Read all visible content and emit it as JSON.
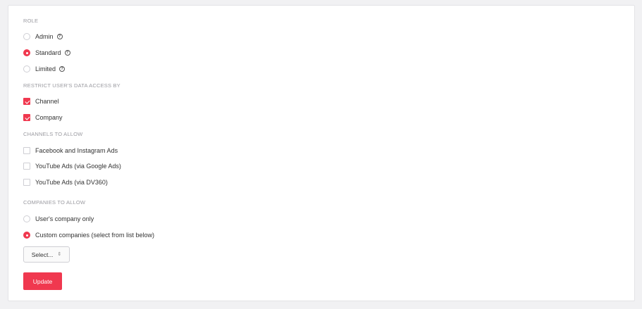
{
  "role": {
    "label": "ROLE",
    "options": [
      {
        "label": "Admin",
        "selected": false,
        "help_icon": "question-circle-icon"
      },
      {
        "label": "Standard",
        "selected": true,
        "help_icon": "question-circle-icon"
      },
      {
        "label": "Limited",
        "selected": false,
        "help_icon": "question-circle-icon"
      }
    ]
  },
  "restrict": {
    "label": "RESTRICT USER'S DATA ACCESS BY",
    "options": [
      {
        "label": "Channel",
        "checked": true
      },
      {
        "label": "Company",
        "checked": true
      }
    ]
  },
  "channels": {
    "label": "CHANNELS TO ALLOW",
    "options": [
      {
        "label": "Facebook and Instagram Ads",
        "checked": false
      },
      {
        "label": "YouTube Ads (via Google Ads)",
        "checked": false
      },
      {
        "label": "YouTube Ads (via DV360)",
        "checked": false
      }
    ]
  },
  "companies": {
    "label": "COMPANIES TO ALLOW",
    "options": [
      {
        "label": "User's company only",
        "selected": false
      },
      {
        "label": "Custom companies (select from list below)",
        "selected": true
      }
    ],
    "select_value": "Select..."
  },
  "update_button": "Update",
  "colors": {
    "accent": "#f0384f",
    "page_bg": "#f1f1f3",
    "card_bg": "#ffffff",
    "muted": "#9a9aa0"
  }
}
